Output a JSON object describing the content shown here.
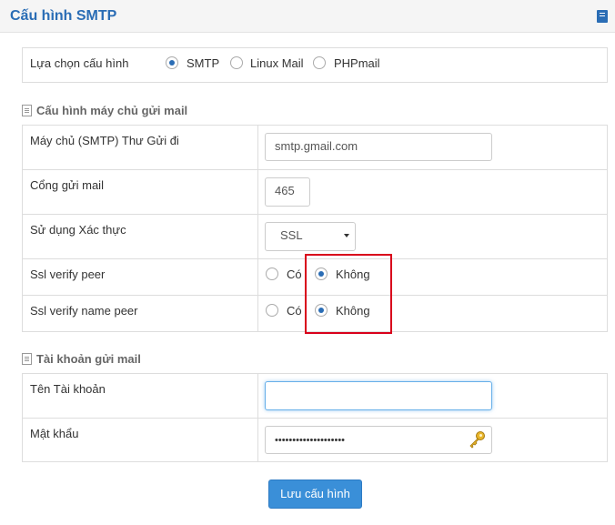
{
  "header": {
    "title": "Cấu hình SMTP",
    "icon": "book-icon"
  },
  "config_select": {
    "label": "Lựa chọn cấu hình",
    "options": [
      {
        "label": "SMTP",
        "selected": true
      },
      {
        "label": "Linux Mail",
        "selected": false
      },
      {
        "label": "PHPmail",
        "selected": false
      }
    ]
  },
  "server_section": {
    "title": "Cấu hình máy chủ gửi mail",
    "host_label": "Máy chủ (SMTP) Thư Gửi đi",
    "host_value": "smtp.gmail.com",
    "port_label": "Cổng gửi mail",
    "port_value": "465",
    "auth_label": "Sử dụng Xác thực",
    "auth_value": "SSL",
    "verify_peer_label": "Ssl verify peer",
    "verify_peer_yes": "Có",
    "verify_peer_no": "Không",
    "verify_peer_selected": "Không",
    "verify_name_peer_label": "Ssl verify name peer",
    "verify_name_peer_yes": "Có",
    "verify_name_peer_no": "Không",
    "verify_name_peer_selected": "Không"
  },
  "account_section": {
    "title": "Tài khoản gửi mail",
    "username_label": "Tên Tài khoản",
    "username_value": "",
    "password_label": "Mật khẩu",
    "password_value": "••••••••••••••••••••"
  },
  "actions": {
    "save_label": "Lưu cấu hình"
  },
  "colors": {
    "accent": "#2a6db5",
    "button": "#3a8fd8",
    "highlight": "#d9001b"
  }
}
